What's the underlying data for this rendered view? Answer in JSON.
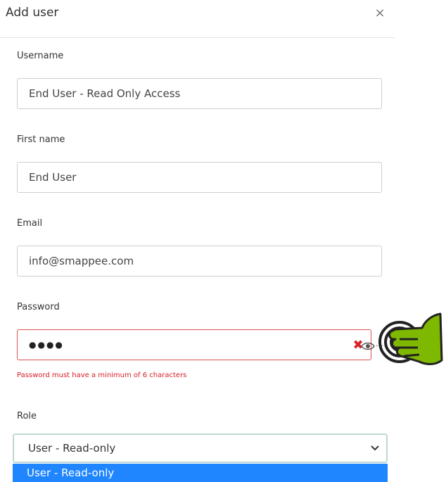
{
  "modal": {
    "title": "Add user",
    "close_symbol": "×"
  },
  "fields": {
    "username": {
      "label": "Username",
      "value": "End User - Read Only Access"
    },
    "first_name": {
      "label": "First name",
      "value": "End User"
    },
    "email": {
      "label": "Email",
      "value": "info@smappee.com"
    },
    "password": {
      "label": "Password",
      "masked_value": "●●●●",
      "clear_symbol": "✖",
      "error": "Password must have a minimum of 6 characters",
      "toggle_icon": "eye-icon",
      "toggle_suffix": "..."
    },
    "role": {
      "label": "Role",
      "selected": "User - Read-only",
      "highlighted_option": "User - Read-only"
    }
  },
  "colors": {
    "error": "#d9202a",
    "option_highlight": "#1f86ff",
    "pointer_green": "#7fb800"
  }
}
